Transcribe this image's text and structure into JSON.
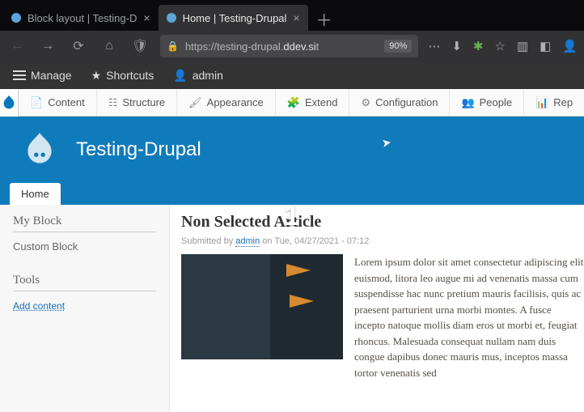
{
  "browser": {
    "tabs": [
      {
        "title": "Block layout | Testing-D",
        "active": false
      },
      {
        "title": "Home | Testing-Drupal",
        "active": true
      }
    ],
    "url_prefix": "https://testing-drupal.",
    "url_bold": "ddev.si",
    "url_suffix": "t",
    "zoom": "90%"
  },
  "adminbar": {
    "manage": "Manage",
    "shortcuts": "Shortcuts",
    "admin_user": "admin"
  },
  "admin_menu": {
    "items": [
      {
        "icon": "📄",
        "label": "Content"
      },
      {
        "icon": "☷",
        "label": "Structure"
      },
      {
        "icon": "🖌",
        "label": "Appearance"
      },
      {
        "icon": "🧩",
        "label": "Extend"
      },
      {
        "icon": "⚙",
        "label": "Configuration"
      },
      {
        "icon": "👥",
        "label": "People"
      },
      {
        "icon": "📊",
        "label": "Rep"
      }
    ]
  },
  "site": {
    "title": "Testing-Drupal",
    "tab_home": "Home"
  },
  "sidebar": {
    "block_title": "My Block",
    "block_body": "Custom Block",
    "tools_title": "Tools",
    "tools_link": "Add content"
  },
  "article": {
    "title": "Non Selected Article",
    "byline_prefix": "Submitted by ",
    "author": "admin",
    "byline_suffix": " on Tue, 04/27/2021 - 07:12",
    "body": "Lorem ipsum dolor sit amet consectetur adipiscing elit euismod, litora leo augue mi ad venenatis massa cum suspendisse hac nunc pretium mauris facilisis, quis ac praesent parturient urna morbi montes. A fusce incepto natoque mollis diam eros ut morbi et, feugiat rhoncus. Malesuada consequat nullam nam duis congue dapibus donec mauris mus, inceptos massa tortor venenatis sed"
  },
  "overlay": {
    "num": "1"
  }
}
